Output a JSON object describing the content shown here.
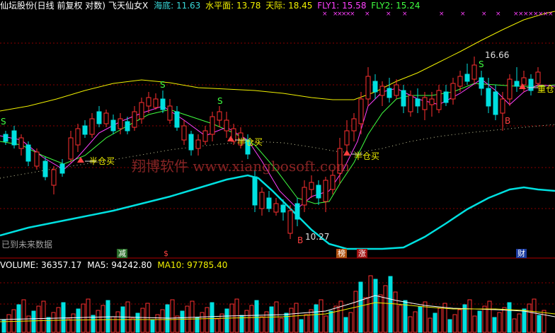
{
  "header": {
    "title": "仙坛股份(日线 前复权 对数)",
    "indicator": "飞天仙女X",
    "items": [
      {
        "label": "海底:",
        "value": "11.63",
        "color": "#38d8d8"
      },
      {
        "label": "水平面:",
        "value": "13.78",
        "color": "#f0f000"
      },
      {
        "label": "天际:",
        "value": "18.45",
        "color": "#f0f000"
      },
      {
        "label": "FLY1:",
        "value": "15.58",
        "color": "#ff40ff"
      },
      {
        "label": "FLY2:",
        "value": "15.24",
        "color": "#40ff40"
      }
    ]
  },
  "volume_header": {
    "items": [
      {
        "label": "VOLUME:",
        "value": "36357.17",
        "color": "#ffffff"
      },
      {
        "label": "MA5:",
        "value": "94242.80",
        "color": "#ffffff"
      },
      {
        "label": "MA10:",
        "value": "97785.40",
        "color": "#f0f000"
      }
    ]
  },
  "annotations": {
    "buy_half_1": "半仓买",
    "buy_half_2": "半仓买",
    "buy_half_3": "半仓买",
    "buy_heavy": "重仓买",
    "high_label": "16.66",
    "low_label": "10.27",
    "signal_s": "S",
    "signal_b": "B",
    "future_note": "已到未来数据"
  },
  "bottom_tags": {
    "jian": "减",
    "dollar": "$",
    "bang": "榜",
    "zhang": "涨",
    "cai": "财"
  },
  "watermark": "翔博软件 www.xiangbosoft.com",
  "colors": {
    "up": "#ff3030",
    "down": "#00e0e0",
    "sea_floor": "#38d8d8",
    "sky": "#f0f000",
    "fly1": "#ff40ff",
    "fly2": "#40ff40",
    "grid": "#8a0000"
  }
}
